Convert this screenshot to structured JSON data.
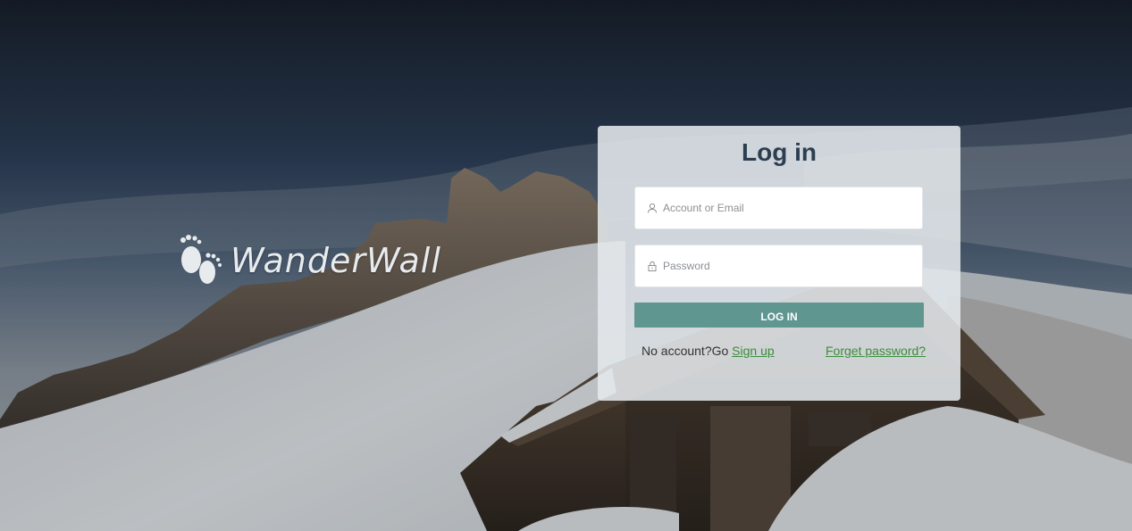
{
  "brand": {
    "name": "WanderWall",
    "logo_icon": "footprints-icon"
  },
  "login": {
    "title": "Log in",
    "account_placeholder": "Account or Email",
    "account_icon": "user-icon",
    "password_placeholder": "Password",
    "password_icon": "lock-icon",
    "submit_label": "LOG IN",
    "no_account_text": "No account?Go ",
    "signup_link": "Sign up",
    "forget_link": "Forget password?"
  },
  "colors": {
    "button": "#5f9690",
    "link": "#3b8d3b",
    "title": "#2c3e50"
  }
}
